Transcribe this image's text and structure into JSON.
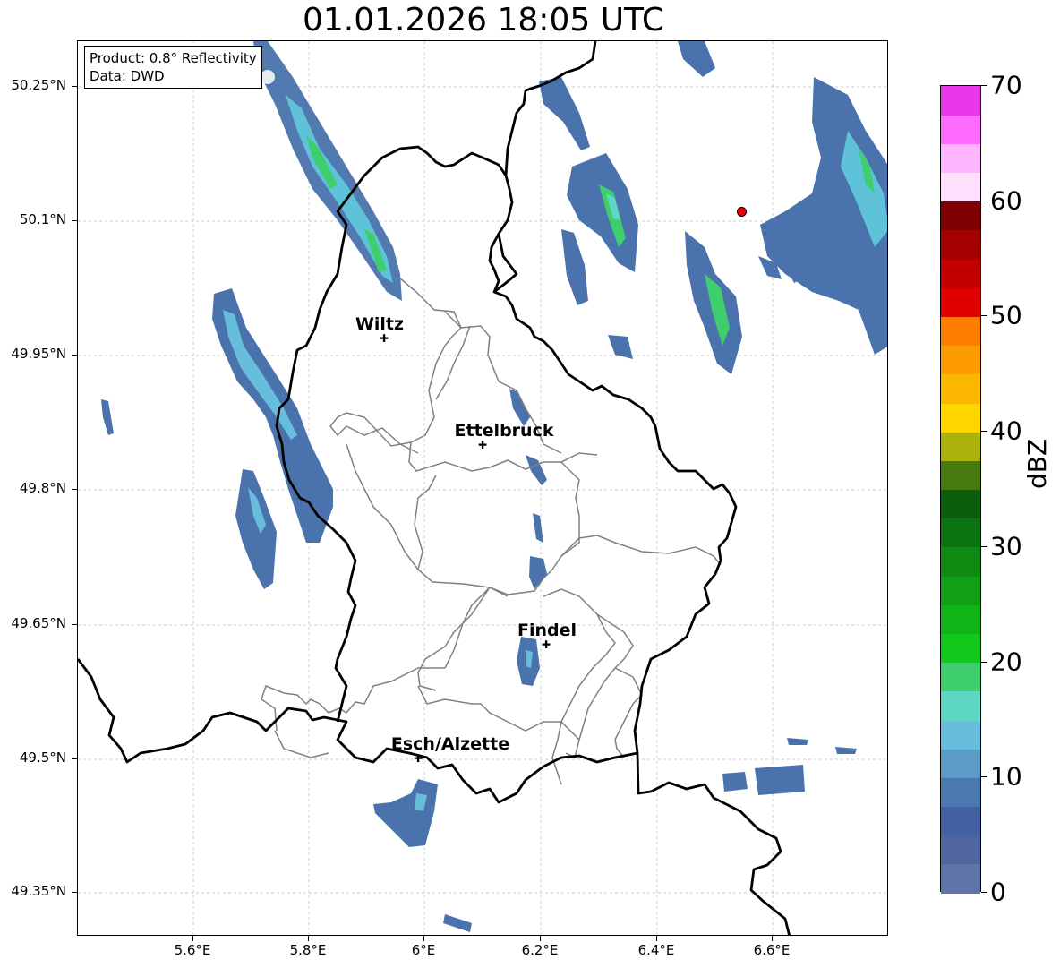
{
  "title": "01.01.2026 18:05 UTC",
  "info_box": {
    "product": "Product: 0.8° Reflectivity",
    "data": "Data: DWD"
  },
  "axes": {
    "y_ticks": [
      "50.25°N",
      "50.1°N",
      "49.95°N",
      "49.8°N",
      "49.65°N",
      "49.5°N",
      "49.35°N"
    ],
    "x_ticks": [
      "5.6°E",
      "5.8°E",
      "6°E",
      "6.2°E",
      "6.4°E",
      "6.6°E"
    ]
  },
  "cities": [
    {
      "name": "Wiltz"
    },
    {
      "name": "Ettelbruck"
    },
    {
      "name": "Findel"
    },
    {
      "name": "Esch/Alzette"
    }
  ],
  "colorbar": {
    "label": "dBZ",
    "ticks": [
      "0",
      "10",
      "20",
      "30",
      "40",
      "50",
      "60",
      "70"
    ],
    "colors": [
      "#5f74a8",
      "#5066a0",
      "#4361a3",
      "#4a79b0",
      "#5b9dc6",
      "#66bedc",
      "#5ed6c4",
      "#3ecf6c",
      "#11c91b",
      "#10b417",
      "#119f16",
      "#0f8a12",
      "#0b7310",
      "#0b5f0c",
      "#467a0e",
      "#aab20b",
      "#ffd500",
      "#fbb600",
      "#fd9b00",
      "#fd7d00",
      "#e10000",
      "#c20000",
      "#a40000",
      "#7f0000",
      "#ffe0fd",
      "#ffb6ff",
      "#ff6bff",
      "#e937ec"
    ]
  },
  "marker_color": "#e8000b"
}
